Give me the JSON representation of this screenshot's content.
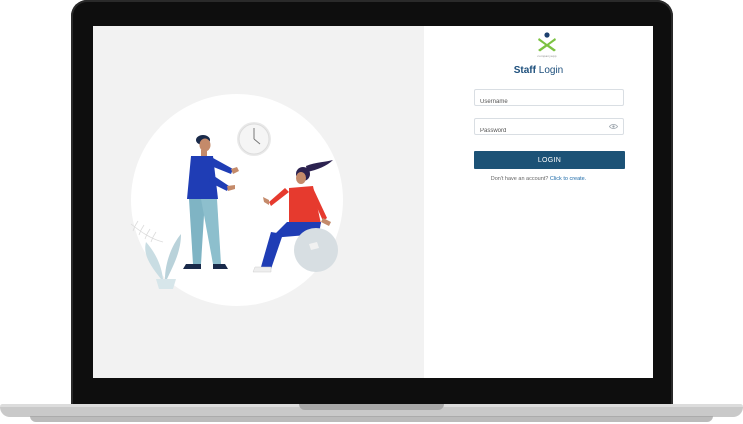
{
  "brand": {
    "logo_text": "companyapp"
  },
  "login": {
    "title_bold": "Staff",
    "title_rest": " Login",
    "username_placeholder": "Username",
    "password_placeholder": "Password",
    "button_label": "LOGIN",
    "signup_prompt": "Don't have an account? ",
    "signup_link": "Click to create."
  },
  "colors": {
    "accent": "#1c5276",
    "title": "#1d4f7c",
    "logo_green": "#7cc242",
    "logo_navy": "#1c3f6e"
  },
  "icons": {
    "password_toggle": "eye-icon"
  }
}
